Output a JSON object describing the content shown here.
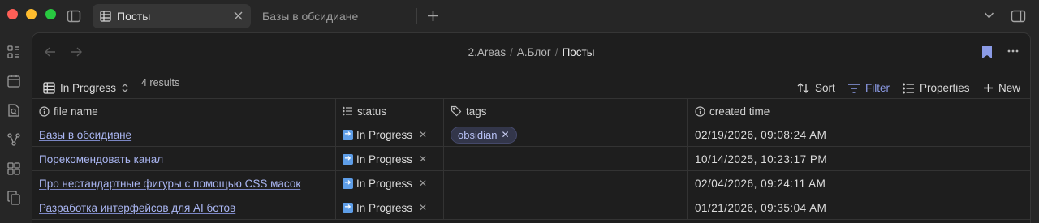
{
  "titlebar": {
    "active_tab": "Посты",
    "second_tab": "Базы в обсидиане",
    "icons": [
      "sidebar-toggle-icon",
      "table-icon",
      "close-icon",
      "plus-icon",
      "chevron-down-icon",
      "right-sidebar-icon"
    ]
  },
  "ribbon": {
    "icons": [
      "dashboard-icon",
      "calendar-icon",
      "search-file-icon",
      "graph-icon",
      "blocks-icon",
      "copy-icon"
    ]
  },
  "breadcrumb": {
    "part1": "2.Areas",
    "part2": "A.Блог",
    "current": "Посты",
    "separator": "/"
  },
  "toolbar": {
    "view_name": "In Progress",
    "results": "4 results",
    "sort_label": "Sort",
    "filter_label": "Filter",
    "properties_label": "Properties",
    "new_label": "New"
  },
  "table": {
    "columns": [
      "file name",
      "status",
      "tags",
      "created time"
    ],
    "rows": [
      {
        "file": "Базы в обсидиане",
        "status": "In Progress",
        "tag": "obsidian",
        "time": "02/19/2026, 09:08:24 AM"
      },
      {
        "file": "Порекомендовать канал",
        "status": "In Progress",
        "tag": "",
        "time": "10/14/2025, 10:23:17 PM"
      },
      {
        "file": "Про нестандартные фигуры с помощью CSS масок",
        "status": "In Progress",
        "tag": "",
        "time": "02/04/2026, 09:24:11 AM"
      },
      {
        "file": "Разработка интерфейсов для AI ботов",
        "status": "In Progress",
        "tag": "",
        "time": "01/21/2026, 09:35:04 AM"
      }
    ]
  },
  "colors": {
    "accent": "#8c9be6",
    "link": "#aab6f2",
    "background": "#1e1e1e",
    "tag_bg": "#33364a"
  }
}
